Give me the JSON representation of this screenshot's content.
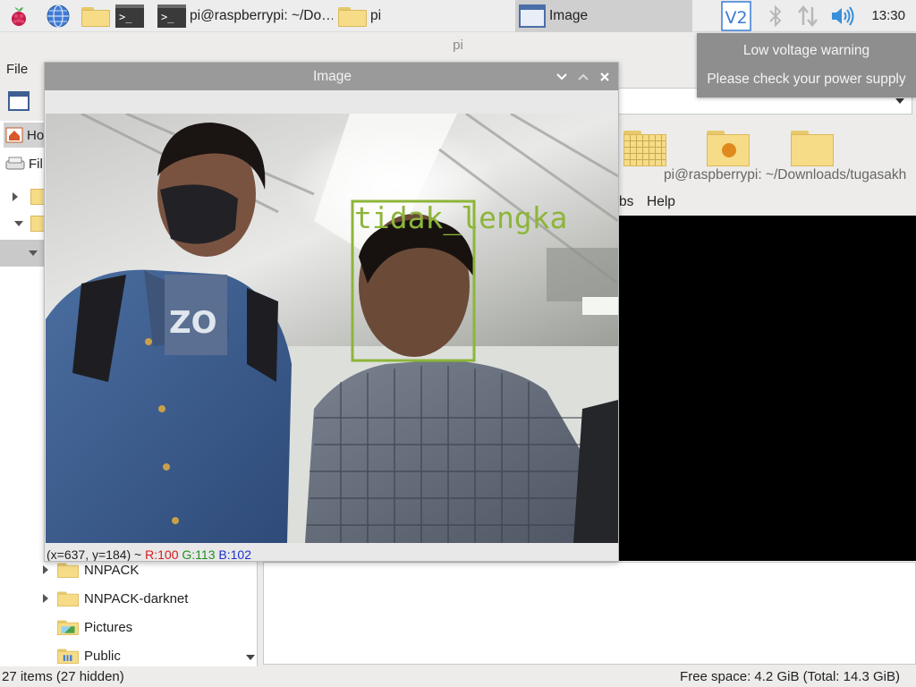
{
  "taskbar": {
    "tasks": [
      {
        "label": "pi@raspberrypi: ~/Do…",
        "icon": "terminal-icon"
      },
      {
        "label": "pi",
        "icon": "folder-icon"
      },
      {
        "label": "Image",
        "icon": "window-icon"
      }
    ],
    "clock": "13:30",
    "tray_icons": [
      "vnc-icon",
      "bluetooth-icon",
      "network-icon",
      "volume-icon"
    ],
    "launchers": [
      "raspberry-menu-icon",
      "web-browser-icon",
      "file-manager-icon",
      "terminal-icon"
    ]
  },
  "file_manager": {
    "window_title": "pi",
    "menu": {
      "file": "File"
    },
    "places": [
      {
        "label": "Ho",
        "icon": "home-icon"
      },
      {
        "label": "Fil",
        "icon": "drive-icon"
      }
    ],
    "tree": [
      {
        "label": "NNPACK",
        "expandable": true
      },
      {
        "label": "NNPACK-darknet",
        "expandable": true
      },
      {
        "label": "Pictures",
        "expandable": false,
        "icon": "pictures-folder-icon"
      },
      {
        "label": "Public",
        "expandable": false,
        "icon": "public-folder-icon"
      }
    ],
    "status_left": "27 items (27 hidden)",
    "status_right": "Free space: 4.2 GiB (Total: 14.3 GiB)"
  },
  "terminal": {
    "title": "pi@raspberrypi: ~/Downloads/tugasakh",
    "menu": [
      "bs",
      "Help"
    ]
  },
  "image_window": {
    "title": "Image",
    "detection_label": "tidak_lengka",
    "box_color": "#8db53a",
    "status": {
      "coords": "(x=637, y=184) ~",
      "r": "R:100",
      "g": "G:113",
      "b": "B:102"
    }
  },
  "notification": {
    "line1": "Low voltage warning",
    "line2": "Please check your power supply"
  }
}
